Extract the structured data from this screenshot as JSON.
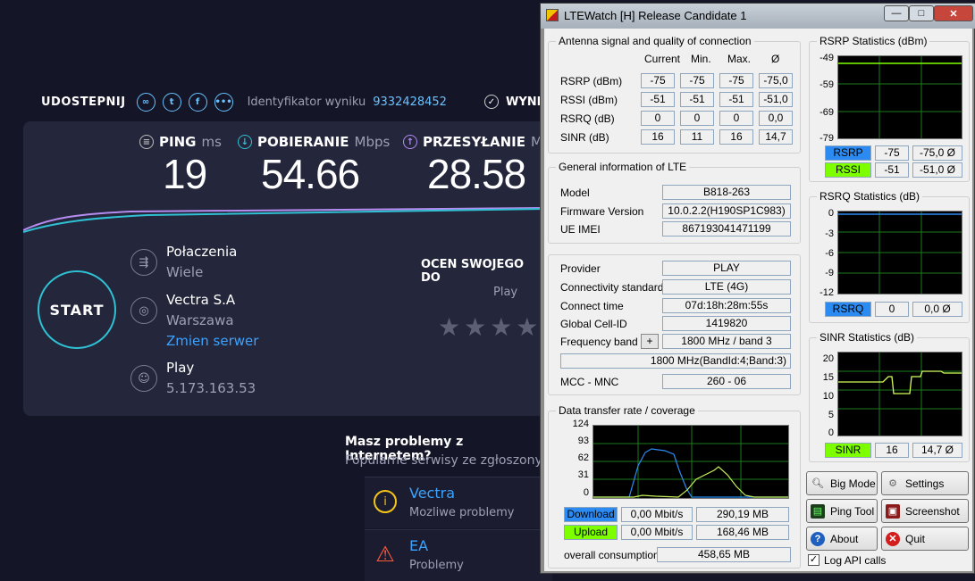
{
  "speedtest": {
    "share_label": "UDOSTEPNIJ",
    "result_id_label": "Identyfikator wyniku",
    "result_id": "9332428452",
    "results_label": "WYNI",
    "ping_label": "PING",
    "ping_unit": "ms",
    "ping_value": "19",
    "download_label": "POBIERANIE",
    "download_unit": "Mbps",
    "download_value": "54.66",
    "upload_label": "PRZESYŁANIE",
    "upload_unit": "Mb",
    "upload_value": "28.58",
    "start_label": "START",
    "connections_label": "Połaczenia",
    "connections_value": "Wiele",
    "isp_name": "Vectra S.A",
    "isp_city": "Warszawa",
    "change_server": "Zmien serwer",
    "host_name": "Play",
    "host_ip": "5.173.163.53",
    "rate_label": "OCEN SWOJEGO DO",
    "rate_provider": "Play",
    "stars": "★★★★",
    "problems_title": "Masz problemy z Internetem?",
    "problems_sub": "Popularne serwisy ze zgłoszony",
    "services": [
      {
        "name": "Vectra",
        "status": "Mozliwe problemy",
        "icon": "info-icon"
      },
      {
        "name": "EA",
        "status": "Problemy",
        "icon": "warning-icon"
      }
    ],
    "colors": {
      "accent": "#2fc1d4",
      "link": "#3ba3ff",
      "download_line": "#2fc1d4",
      "upload_line": "#9b5de5"
    }
  },
  "lte": {
    "title": "LTEWatch [H]   Release Candidate 1",
    "signal": {
      "group_label": "Antenna signal and quality of connection",
      "headers": [
        "Current",
        "Min.",
        "Max.",
        "Ø"
      ],
      "rows": [
        {
          "label": "RSRP (dBm)",
          "values": [
            "-75",
            "-75",
            "-75",
            "-75,0"
          ]
        },
        {
          "label": "RSSI (dBm)",
          "values": [
            "-51",
            "-51",
            "-51",
            "-51,0"
          ]
        },
        {
          "label": "RSRQ (dB)",
          "values": [
            "0",
            "0",
            "0",
            "0,0"
          ]
        },
        {
          "label": "SINR (dB)",
          "values": [
            "16",
            "11",
            "16",
            "14,7"
          ]
        }
      ]
    },
    "general": {
      "group_label": "General information of LTE",
      "model_label": "Model",
      "model": "B818-263",
      "fw_label": "Firmware Version",
      "fw": "10.0.2.2(H190SP1C983)",
      "imei_label": "UE IMEI",
      "imei": "867193041471199"
    },
    "network": {
      "provider_label": "Provider",
      "provider": "PLAY",
      "std_label": "Connectivity standard",
      "std": "LTE (4G)",
      "connect_label": "Connect time",
      "connect": "07d:18h:28m:55s",
      "cell_label": "Global Cell-ID",
      "cell": "1419820",
      "band_label": "Frequency band",
      "band_btn": "+",
      "band": "1800 MHz / band 3",
      "band_detail": "1800 MHz(BandId:4;Band:3)",
      "mcc_label": "MCC - MNC",
      "mcc": "260 - 06"
    },
    "transfer": {
      "group_label": "Data transfer rate / coverage",
      "y_ticks": [
        "124",
        "93",
        "62",
        "31",
        "0"
      ],
      "download_label": "Download",
      "download_rate": "0,00 Mbit/s",
      "download_total": "290,19 MB",
      "upload_label": "Upload",
      "upload_rate": "0,00 Mbit/s",
      "upload_total": "168,46 MB",
      "overall_label": "overall consumption",
      "overall": "458,65 MB"
    },
    "rsrp_stats": {
      "group_label": "RSRP Statistics (dBm)",
      "y_ticks": [
        "-49",
        "-59",
        "-69",
        "-79"
      ],
      "rsrp_label": "RSRP",
      "rsrp_cur": "-75",
      "rsrp_avg": "-75,0 Ø",
      "rssi_label": "RSSI",
      "rssi_cur": "-51",
      "rssi_avg": "-51,0 Ø"
    },
    "rsrq_stats": {
      "group_label": "RSRQ Statistics (dB)",
      "y_ticks": [
        "0",
        "-3",
        "-6",
        "-9",
        "-12"
      ],
      "label": "RSRQ",
      "cur": "0",
      "avg": "0,0 Ø"
    },
    "sinr_stats": {
      "group_label": "SINR Statistics (dB)",
      "y_ticks": [
        "20",
        "15",
        "10",
        "5",
        "0"
      ],
      "label": "SINR",
      "cur": "16",
      "avg": "14,7 Ø"
    },
    "buttons": {
      "big_mode": "Big Mode",
      "settings": "Settings",
      "ping_tool": "Ping Tool",
      "screenshot": "Screenshot",
      "about": "About",
      "quit": "Quit"
    },
    "log_api": "Log API calls",
    "log_api_checked": true,
    "colors": {
      "download": "#2b8bf2",
      "upload": "#7dff00",
      "sinr_line": "#d7ff5b",
      "grid": "#1c7a1c"
    }
  }
}
